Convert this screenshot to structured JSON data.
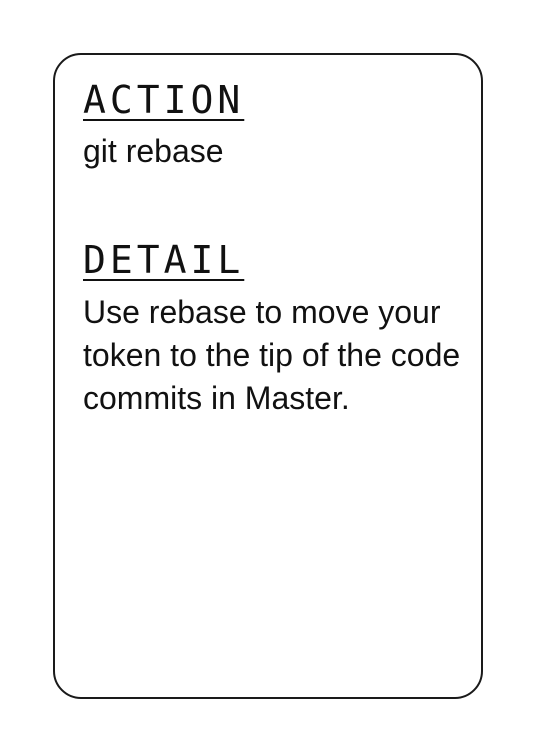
{
  "card": {
    "action_heading": "ACTION",
    "action_text": "git rebase",
    "detail_heading": "DETAIL",
    "detail_text": "Use rebase to move your token to the tip of the code commits in Master."
  }
}
